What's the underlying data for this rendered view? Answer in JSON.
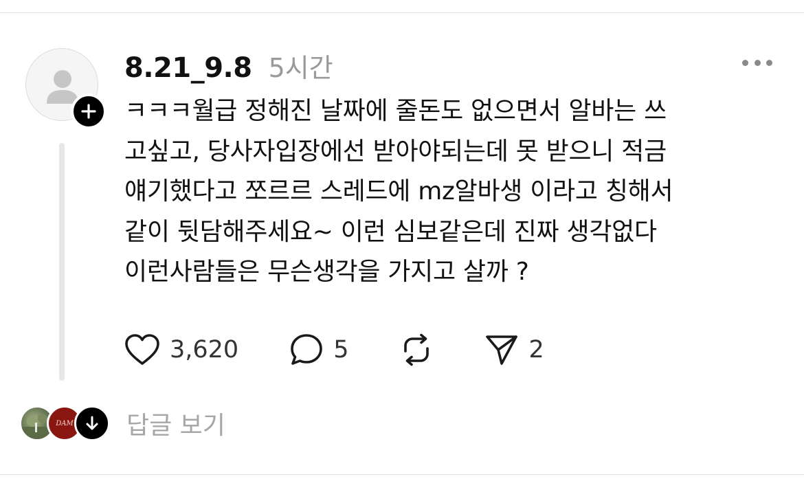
{
  "post": {
    "username": "8.21_9.8",
    "timestamp": "5시간",
    "body": "ㅋㅋㅋ월급 정해진 날짜에 줄돈도 없으면서 알바는 쓰\n고싶고, 당사자입장에선 받아야되는데 못 받으니 적금\n얘기했다고 쪼르르 스레드에 mz알바생 이라고 칭해서\n같이 뒷담해주세요~ 이런 심보같은데 진짜 생각없다\n이런사람들은 무슨생각을 가지고 살까 ?",
    "like_count": "3,620",
    "reply_count": "5",
    "share_count": "2"
  },
  "replies": {
    "view_label": "답글 보기",
    "logo_text": "DAM"
  },
  "icons": {
    "avatar": "person-placeholder-icon",
    "follow": "plus-icon",
    "more": "ellipsis-icon",
    "like": "heart-icon",
    "reply": "speech-bubble-icon",
    "repost": "repost-icon",
    "share": "send-icon",
    "reply_avatar_badge": "arrow-down-icon"
  },
  "colors": {
    "text": "#111111",
    "muted": "#9a9a9a",
    "thread_line": "#e7e7e7"
  }
}
